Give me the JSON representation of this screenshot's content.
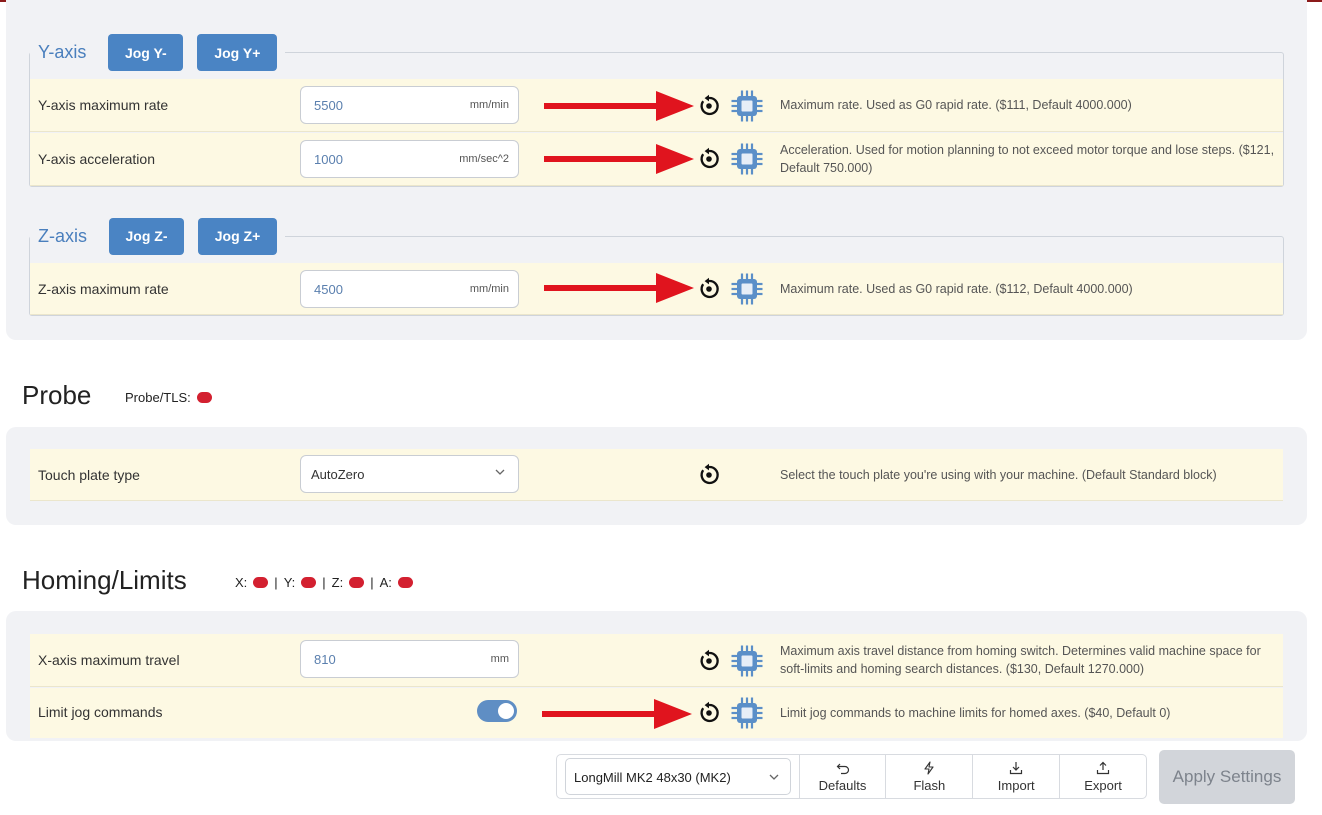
{
  "colors": {
    "accent": "#4a84c4",
    "row_bg": "#fdf9e3",
    "card_bg": "#f1f2f5",
    "status_red": "#d32030",
    "arrow_red": "#e0141e"
  },
  "y_axis": {
    "title": "Y-axis",
    "jog_minus": "Jog Y-",
    "jog_plus": "Jog Y+",
    "rows": [
      {
        "label": "Y-axis maximum rate",
        "value": "5500",
        "unit": "mm/min",
        "desc": "Maximum rate. Used as G0 rapid rate. ($111, Default 4000.000)"
      },
      {
        "label": "Y-axis acceleration",
        "value": "1000",
        "unit": "mm/sec^2",
        "desc": "Acceleration. Used for motion planning to not exceed motor torque and lose steps. ($121, Default 750.000)"
      }
    ]
  },
  "z_axis": {
    "title": "Z-axis",
    "jog_minus": "Jog Z-",
    "jog_plus": "Jog Z+",
    "rows": [
      {
        "label": "Z-axis maximum rate",
        "value": "4500",
        "unit": "mm/min",
        "desc": "Maximum rate. Used as G0 rapid rate. ($112, Default 4000.000)"
      }
    ]
  },
  "probe": {
    "title": "Probe",
    "status_label": "Probe/TLS:",
    "rows": [
      {
        "label": "Touch plate type",
        "value": "AutoZero",
        "desc": "Select the touch plate you're using with your machine. (Default Standard block)"
      }
    ]
  },
  "homing": {
    "title": "Homing/Limits",
    "status": {
      "x": "X:",
      "y": "Y:",
      "z": "Z:",
      "a": "A:",
      "sep": "|"
    },
    "rows": [
      {
        "label": "X-axis maximum travel",
        "value": "810",
        "unit": "mm",
        "desc": "Maximum axis travel distance from homing switch. Determines valid machine space for soft-limits and homing search distances. ($130, Default 1270.000)"
      },
      {
        "label": "Limit jog commands",
        "toggle_on": true,
        "desc": "Limit jog commands to machine limits for homed axes. ($40, Default 0)"
      }
    ]
  },
  "footer": {
    "machine": "LongMill MK2 48x30 (MK2)",
    "defaults": "Defaults",
    "flash": "Flash",
    "import": "Import",
    "export": "Export",
    "apply": "Apply Settings"
  },
  "icons": {
    "reset": "reset-icon",
    "chip": "chip-icon",
    "arrow": "red-arrow"
  }
}
